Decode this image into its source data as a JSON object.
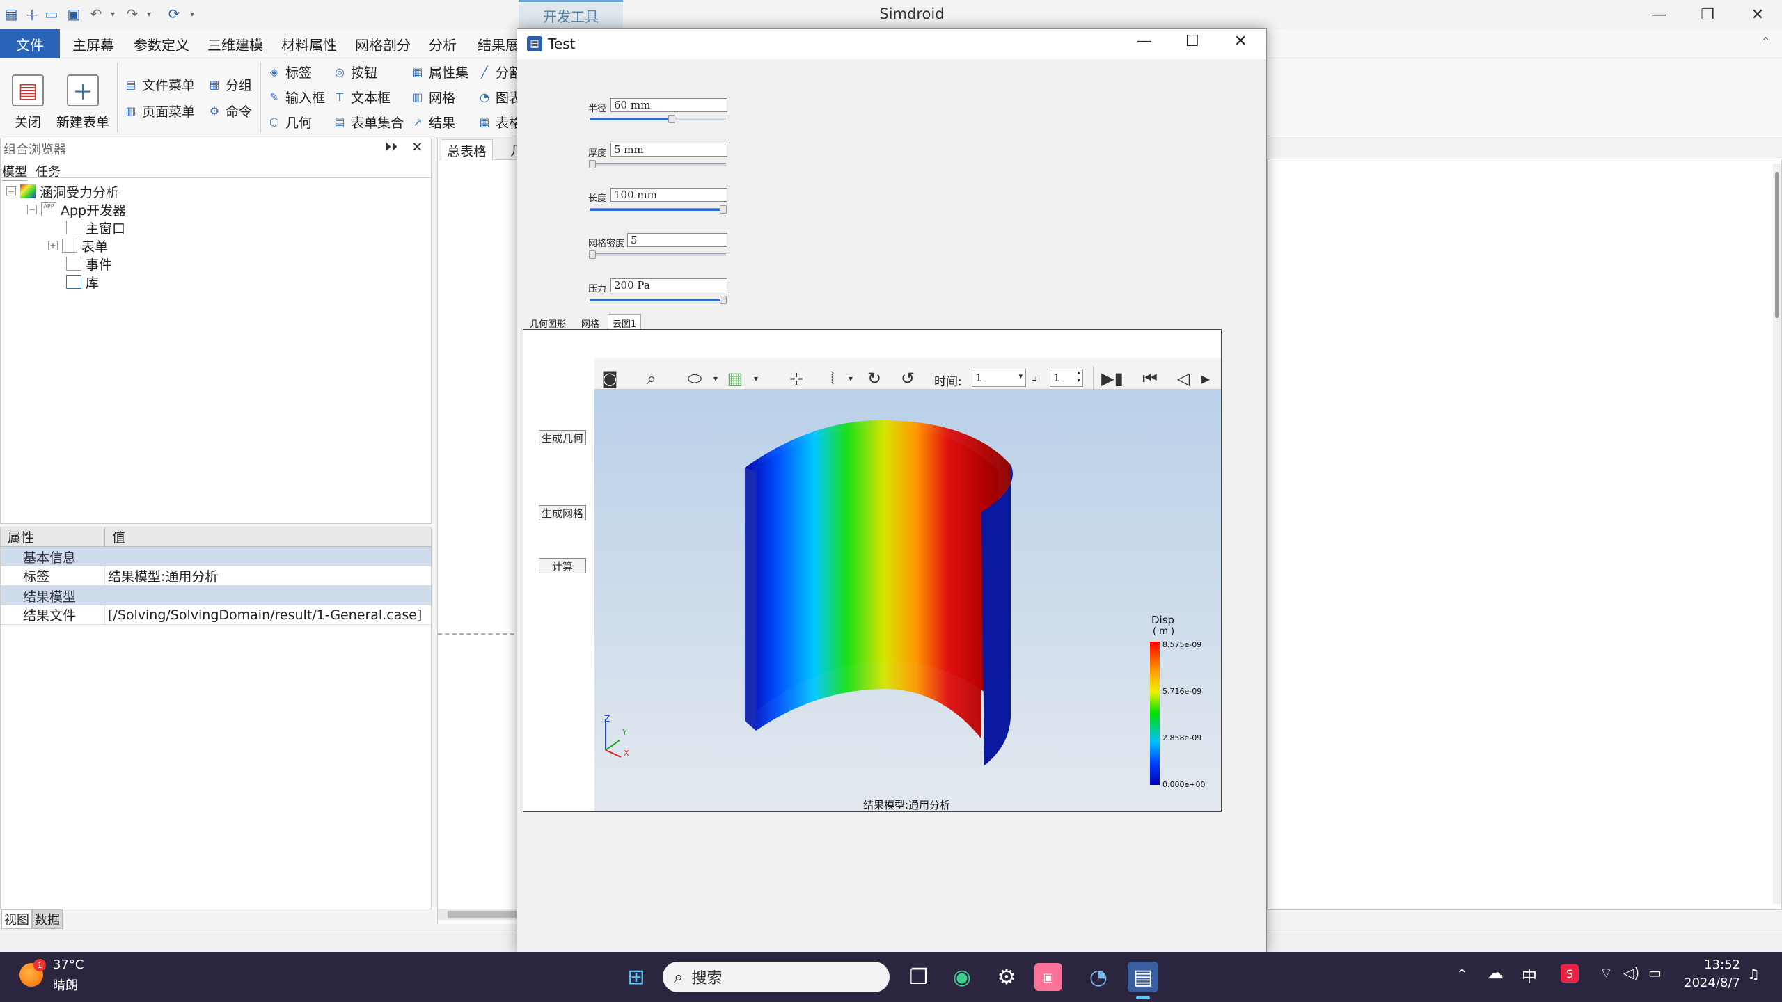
{
  "window": {
    "app_title": "Simdroid",
    "dev_tab": "开发工具"
  },
  "menu": {
    "items": [
      "文件",
      "主屏幕",
      "参数定义",
      "三维建模",
      "材料属性",
      "网格剖分",
      "分析",
      "结果展"
    ]
  },
  "ribbon": {
    "close": "关闭",
    "new_form": "新建表单",
    "file_menu": "文件菜单",
    "page_menu": "页面菜单",
    "group": "分组",
    "command": "命令",
    "label": "标签",
    "input_box": "输入框",
    "geometry": "几何",
    "button": "按钮",
    "text_box": "文本框",
    "form_set": "表单集合",
    "attr_set": "属性集",
    "mesh": "网格",
    "result": "结果",
    "split": "分割",
    "chart": "图表",
    "table": "表格"
  },
  "browser": {
    "title": "组合浏览器",
    "tab_model": "模型",
    "tab_task": "任务",
    "tree": {
      "root": "涵洞受力分析",
      "app": "App开发器",
      "main_window": "主窗口",
      "form": "表单",
      "event": "事件",
      "library": "库"
    }
  },
  "props": {
    "col_attr": "属性",
    "col_value": "值",
    "cat_basic": "基本信息",
    "label_key": "标签",
    "label_value": "结果模型:通用分析",
    "cat_result": "结果模型",
    "file_key": "结果文件",
    "file_value": "[/Solving/SolvingDomain/result/1-General.case]"
  },
  "bottom_tabs": {
    "view": "视图",
    "data": "数据"
  },
  "doc": {
    "tab_main": "总表格",
    "tab_2": "几"
  },
  "dialog": {
    "title": "Test",
    "params": [
      {
        "label": "半径",
        "value": "60 mm",
        "fill": 0.6
      },
      {
        "label": "厚度",
        "value": "5 mm",
        "fill": 0.02
      },
      {
        "label": "长度",
        "value": "100 mm",
        "fill": 0.98
      },
      {
        "label": "网格密度",
        "value": "5",
        "fill": 0.02
      },
      {
        "label": "压力",
        "value": "200 Pa",
        "fill": 0.98
      }
    ],
    "tabs": [
      "几何图形",
      "网格",
      "云图1"
    ],
    "side_buttons": [
      "生成几何",
      "生成网格",
      "计算"
    ],
    "toolbar": {
      "time_label": "时间:",
      "time_value": "1",
      "step_value": "1"
    },
    "legend": {
      "title": "Disp",
      "unit": "( m )",
      "ticks": [
        "8.575e-09",
        "5.716e-09",
        "2.858e-09",
        "0.000e+00"
      ]
    },
    "model_caption": "结果模型:通用分析",
    "axes": {
      "z": "Z",
      "y": "Y",
      "x": "X"
    }
  },
  "taskbar": {
    "weather_temp": "37°C",
    "weather_desc": "晴朗",
    "weather_badge": "1",
    "search_placeholder": "搜索",
    "ime": "中",
    "time": "13:52",
    "date": "2024/8/7"
  }
}
